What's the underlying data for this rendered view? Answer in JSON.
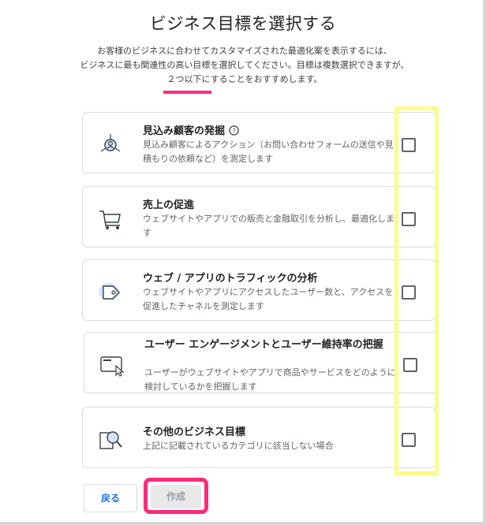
{
  "page": {
    "title": "ビジネス目標を選択する",
    "description_lines": [
      "お客様のビジネスに合わせてカスタマイズされた最適化案を表示するには、",
      "ビジネスに最も関連性の高い目標を選択してください。目標は複数選択できますが、",
      "２つ以下にすることをおすすめします。"
    ]
  },
  "cards": [
    {
      "title": "見込み顧客の発掘",
      "help_icon": "?",
      "desc": "見込み顧客によるアクション（お問い合わせフォームの送信や見積もりの依頼など）を測定します",
      "icon": "lead-icon",
      "checked": false
    },
    {
      "title": "売上の促進",
      "desc": "ウェブサイトやアプリでの販売と金融取引を分析し、最適化します",
      "icon": "cart-icon",
      "checked": false
    },
    {
      "title": "ウェブ / アプリのトラフィックの分析",
      "desc": "ウェブサイトやアプリにアクセスしたユーザー数と、アクセスを促進したチャネルを測定します",
      "icon": "tag-icon",
      "checked": false
    },
    {
      "title": "ユーザー エンゲージメントとユーザー維持率の把握",
      "desc": "ユーザーがウェブサイトやアプリで商品やサービスをどのように検討しているかを把握します",
      "icon": "screen-cursor-icon",
      "checked": false
    },
    {
      "title": "その他のビジネス目標",
      "desc": "上記に記載されているカテゴリに該当しない場合",
      "icon": "magnifier-icon",
      "checked": false
    }
  ],
  "buttons": {
    "back": "戻る",
    "create": "作成"
  },
  "colors": {
    "highlight_yellow": "#fdfb8a",
    "highlight_pink": "#ff2a7a",
    "primary_blue": "#1a73e8"
  }
}
